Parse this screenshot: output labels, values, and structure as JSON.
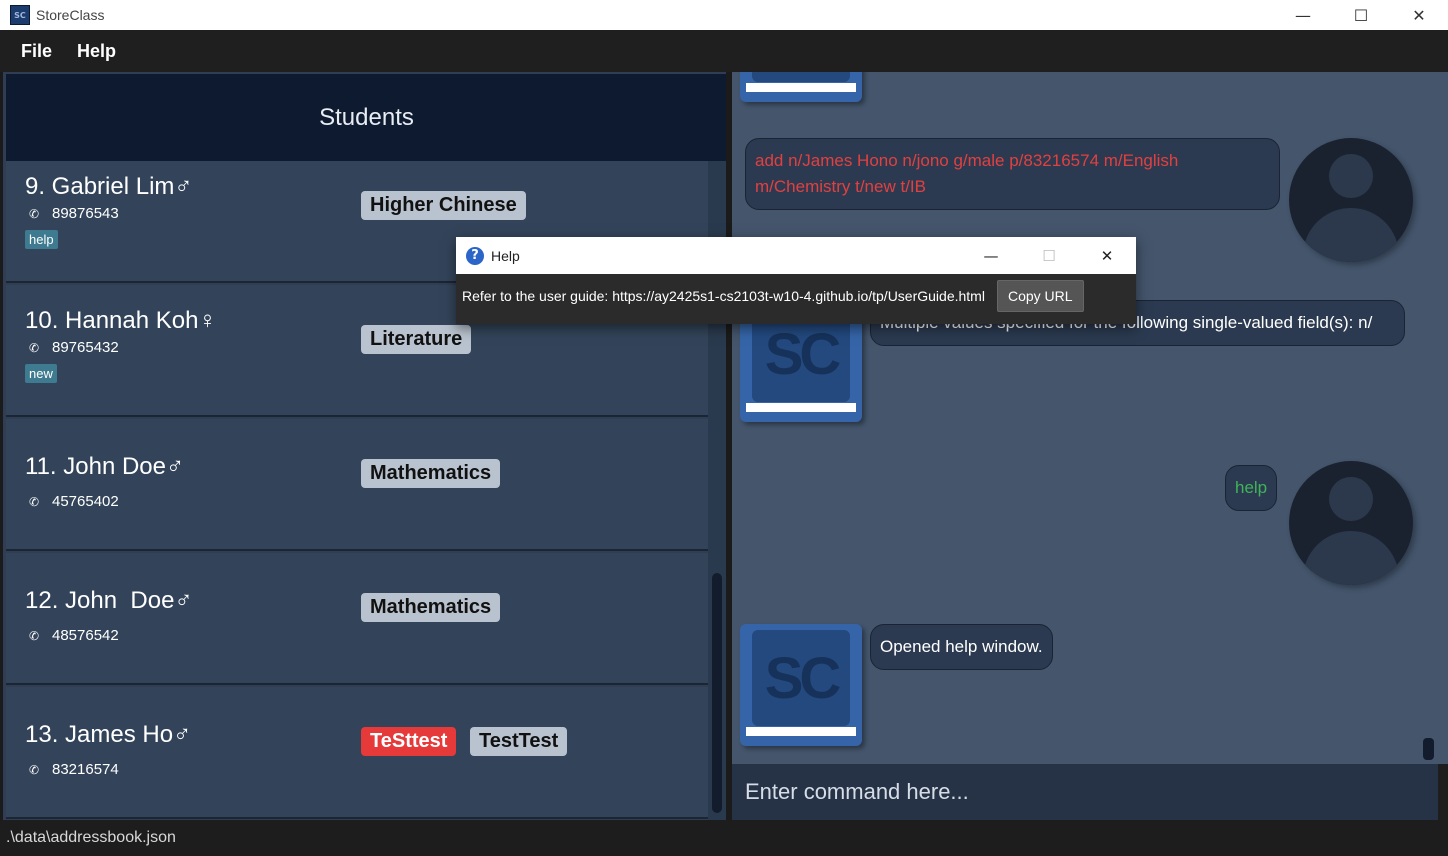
{
  "window": {
    "title": "StoreClass",
    "controls": {
      "minimize": "—",
      "maximize": "☐",
      "close": "✕"
    }
  },
  "menu": {
    "items": [
      "File",
      "Help"
    ]
  },
  "students": {
    "header": "Students",
    "list": [
      {
        "name": "9. Gabriel Lim♂",
        "phone": "89876543",
        "tag": "help",
        "subjects": [
          {
            "label": "Higher Chinese",
            "color": "#b9c3cf"
          }
        ]
      },
      {
        "name": "10. Hannah Koh♀",
        "phone": "89765432",
        "tag": "new",
        "subjects": [
          {
            "label": "Literature",
            "color": "#b9c3cf"
          }
        ]
      },
      {
        "name": "11. John Doe♂",
        "phone": "45765402",
        "tag": "",
        "subjects": [
          {
            "label": "Mathematics",
            "color": "#b9c3cf"
          }
        ]
      },
      {
        "name": "12. John  Doe♂",
        "phone": "48576542",
        "tag": "",
        "subjects": [
          {
            "label": "Mathematics",
            "color": "#b9c3cf"
          }
        ]
      },
      {
        "name": "13. James Ho♂",
        "phone": "83216574",
        "tag": "",
        "subjects": [
          {
            "label": "TeSttest",
            "color": "#e5393a"
          },
          {
            "label": "TestTest",
            "color": "#b9c3cf"
          }
        ]
      }
    ]
  },
  "chat": {
    "messages": [
      {
        "from": "user",
        "text": "add n/James Hono n/jono g/male p/83216574 m/English m/Chemistry t/new t/IB",
        "status": "error"
      },
      {
        "from": "app",
        "text": "Multiple values specified for the following single-valued field(s): n/"
      },
      {
        "from": "user",
        "text": "help",
        "status": "ok"
      },
      {
        "from": "app",
        "text": "Opened help window."
      }
    ],
    "logo_text": "SC"
  },
  "command": {
    "placeholder": "Enter command here..."
  },
  "status": {
    "path": ".\\data\\addressbook.json"
  },
  "help_dialog": {
    "title": "Help",
    "message": "Refer to the user guide: https://ay2425s1-cs2103t-w10-4.github.io/tp/UserGuide.html",
    "copy_button": "Copy URL"
  },
  "colors": {
    "accent": "#0e1a30",
    "error": "#e24040",
    "success": "#3fb35a"
  }
}
